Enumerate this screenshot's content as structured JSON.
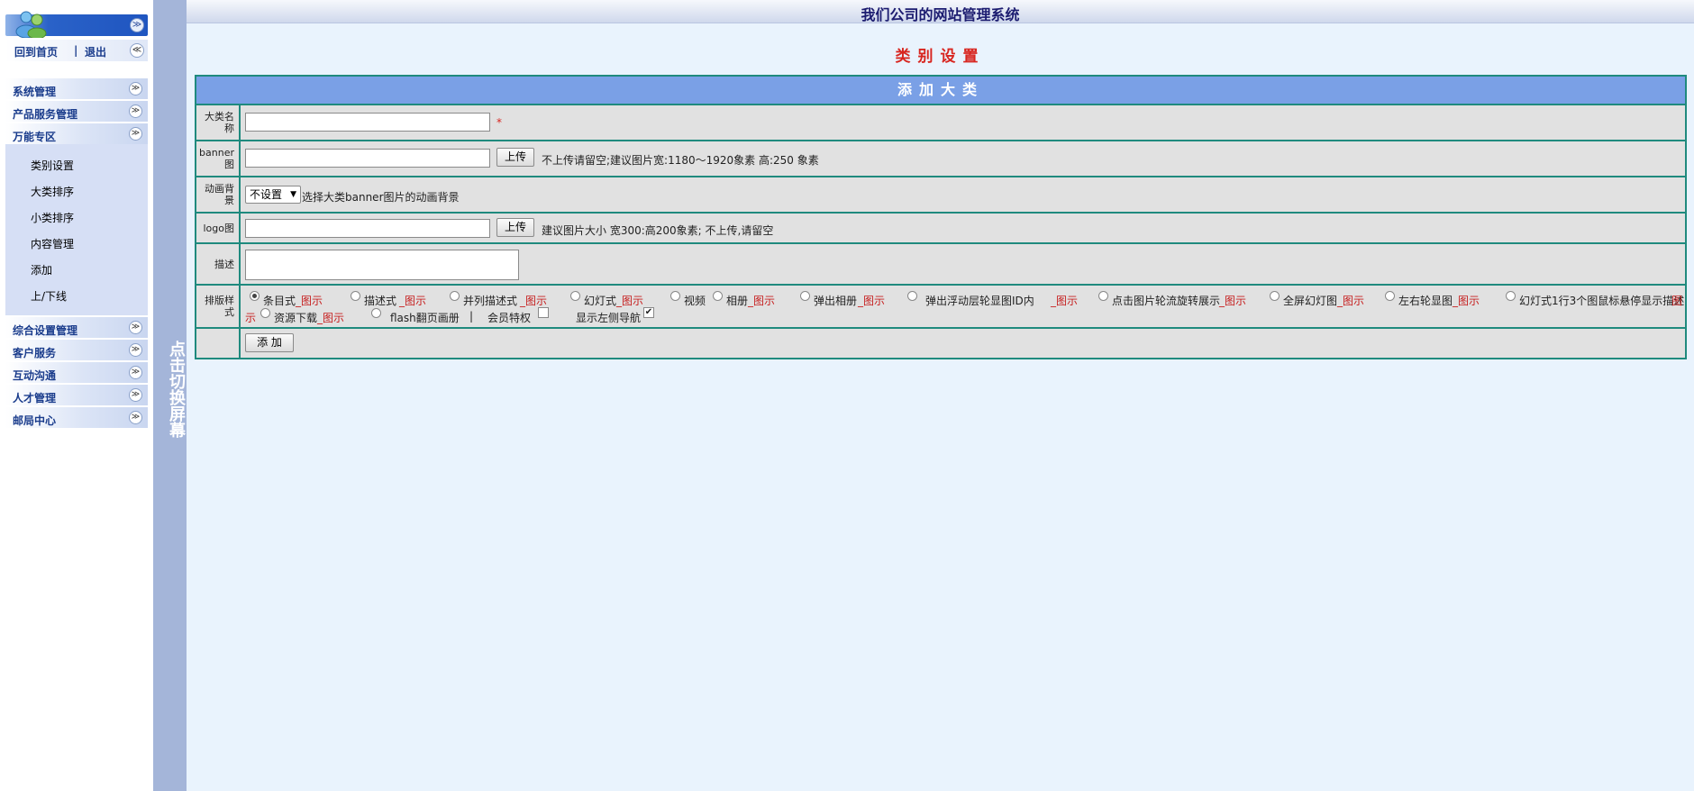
{
  "sidebar": {
    "home_link": "回到首页",
    "separator": "|",
    "logout_link": "退出",
    "menus": [
      {
        "label": "系统管理"
      },
      {
        "label": "产品服务管理"
      },
      {
        "label": "万能专区"
      },
      {
        "label": "综合设置管理"
      },
      {
        "label": "客户服务"
      },
      {
        "label": "互动沟通"
      },
      {
        "label": "人才管理"
      },
      {
        "label": "邮局中心"
      }
    ],
    "submenu": [
      {
        "label": "类别设置"
      },
      {
        "label": "大类排序"
      },
      {
        "label": "小类排序"
      },
      {
        "label": "内容管理"
      },
      {
        "label": "添加"
      },
      {
        "label": "上/下线"
      }
    ]
  },
  "splitter": {
    "label": "点击切换屏幕"
  },
  "header": {
    "title": "我们公司的网站管理系统"
  },
  "page": {
    "title": "类别设置"
  },
  "form": {
    "header": "添加大类",
    "rows": {
      "name": {
        "label_1": "大类名",
        "label_2": "称",
        "required": "*"
      },
      "banner": {
        "label_1": "banner",
        "label_2": "图",
        "upload": "上传",
        "hint": "不上传请留空;建议图片宽:1180～1920象素 高:250 象素"
      },
      "animation": {
        "label_1": "动画背",
        "label_2": "景",
        "selected": "不设置",
        "hint": "选择大类banner图片的动画背景"
      },
      "logo": {
        "label": "logo图",
        "upload": "上传",
        "hint": "建议图片大小 宽300:高200象素; 不上传,请留空"
      },
      "description": {
        "label": "描述"
      },
      "style": {
        "label_1": "排版样",
        "label_2": "式",
        "options": [
          {
            "label": "条目式",
            "link": "_图示",
            "checked": true
          },
          {
            "label": "描述式",
            "link": "_图示"
          },
          {
            "label": "并列描述式",
            "link": "_图示"
          },
          {
            "label": "幻灯式",
            "link": "_图示"
          },
          {
            "label": "视频",
            "link": ""
          },
          {
            "label": "相册",
            "link": "_图示"
          },
          {
            "label": "弹出相册",
            "link": "_图示"
          },
          {
            "label": "弹出浮动层轮显图ID内",
            "link": "_图示"
          },
          {
            "label": "点击图片轮流旋转展示",
            "link": "_图示"
          },
          {
            "label": "全屏幻灯图",
            "link": "_图示"
          },
          {
            "label": "左右轮显图",
            "link": "_图示"
          },
          {
            "label": "幻灯式1行3个图鼠标悬停显示描述",
            "link": "图"
          },
          {
            "label": "资源下载",
            "link": "_图示"
          },
          {
            "label": "flash翻页画册",
            "link": ""
          }
        ],
        "wrap_link": "示",
        "separator": "|",
        "member_label": "会员特权",
        "nav_label": "显示左侧导航",
        "check_mark": "✔"
      },
      "submit": {
        "label": "添 加"
      }
    }
  },
  "icons": {
    "collapse": "≪",
    "expand": "≫"
  }
}
